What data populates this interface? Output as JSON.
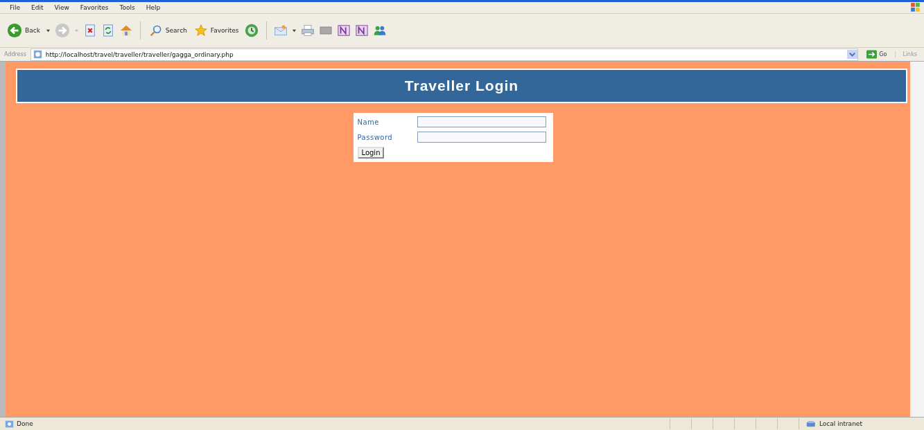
{
  "menu": [
    "File",
    "Edit",
    "View",
    "Favorites",
    "Tools",
    "Help"
  ],
  "toolbar": {
    "back_label": "Back",
    "forward_disabled": true,
    "search_label": "Search",
    "favorites_label": "Favorites"
  },
  "address_bar": {
    "label": "Address",
    "url": "http://localhost/travel/traveller/traveller/gagga_ordinary.php",
    "go_label": "Go",
    "links_label": "Links"
  },
  "page": {
    "header": "Traveller Login",
    "form": {
      "fields": [
        {
          "label": "Name"
        },
        {
          "label": "Password"
        }
      ],
      "button": "Login"
    }
  },
  "status_bar": {
    "text": "Done",
    "zone": "Local intranet"
  }
}
